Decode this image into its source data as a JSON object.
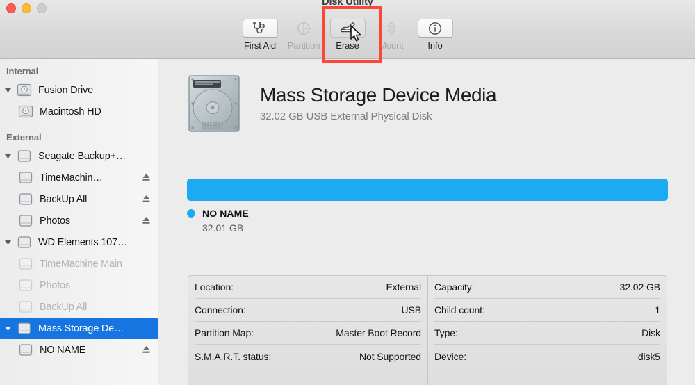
{
  "window": {
    "title": "Disk Utility",
    "traffic_lights": [
      "close",
      "minimize",
      "zoom"
    ]
  },
  "toolbar": {
    "items": [
      {
        "label": "First Aid",
        "icon": "stethoscope-icon",
        "enabled": true,
        "active": false
      },
      {
        "label": "Partition",
        "icon": "pie-chart-icon",
        "enabled": false,
        "active": false
      },
      {
        "label": "Erase",
        "icon": "erase-disk-icon",
        "enabled": true,
        "active": true
      },
      {
        "label": "Mount",
        "icon": "mount-icon",
        "enabled": false,
        "active": false
      },
      {
        "label": "Info",
        "icon": "info-circle-icon",
        "enabled": true,
        "active": false
      }
    ],
    "annotation": {
      "target": "Erase",
      "color": "#f9473c",
      "shape": "rectangle"
    },
    "cursor": {
      "type": "arrow-pointer",
      "over": "Erase"
    }
  },
  "sidebar": {
    "groups": [
      {
        "label": "Internal",
        "rows": [
          {
            "label": "Fusion Drive",
            "icon": "internal-disk-icon",
            "indent": 1,
            "twisty": "down",
            "eject": false,
            "selected": false,
            "dimmed": false
          },
          {
            "label": "Macintosh HD",
            "icon": "internal-disk-icon",
            "indent": 2,
            "twisty": "none",
            "eject": false,
            "selected": false,
            "dimmed": false
          }
        ]
      },
      {
        "label": "External",
        "rows": [
          {
            "label": "Seagate Backup+…",
            "icon": "external-disk-icon",
            "indent": 1,
            "twisty": "down",
            "eject": false,
            "selected": false,
            "dimmed": false
          },
          {
            "label": "TimeMachin…",
            "icon": "external-disk-icon",
            "indent": 2,
            "twisty": "none",
            "eject": true,
            "selected": false,
            "dimmed": false
          },
          {
            "label": "BackUp All",
            "icon": "external-disk-icon",
            "indent": 2,
            "twisty": "none",
            "eject": true,
            "selected": false,
            "dimmed": false
          },
          {
            "label": "Photos",
            "icon": "external-disk-icon",
            "indent": 2,
            "twisty": "none",
            "eject": true,
            "selected": false,
            "dimmed": false
          },
          {
            "label": "WD Elements 107…",
            "icon": "external-disk-icon",
            "indent": 1,
            "twisty": "down",
            "eject": false,
            "selected": false,
            "dimmed": false
          },
          {
            "label": "TimeMachine Main",
            "icon": "external-disk-icon",
            "indent": 2,
            "twisty": "none",
            "eject": false,
            "selected": false,
            "dimmed": true
          },
          {
            "label": "Photos",
            "icon": "external-disk-icon",
            "indent": 2,
            "twisty": "none",
            "eject": false,
            "selected": false,
            "dimmed": true
          },
          {
            "label": "BackUp All",
            "icon": "external-disk-icon",
            "indent": 2,
            "twisty": "none",
            "eject": false,
            "selected": false,
            "dimmed": true
          },
          {
            "label": "Mass Storage De…",
            "icon": "external-disk-icon",
            "indent": 1,
            "twisty": "down",
            "eject": false,
            "selected": true,
            "dimmed": false
          },
          {
            "label": "NO NAME",
            "icon": "external-disk-icon",
            "indent": 2,
            "twisty": "none",
            "eject": true,
            "selected": false,
            "dimmed": false
          }
        ]
      }
    ]
  },
  "main": {
    "disk_icon": "hard-drive-photo-icon",
    "title": "Mass Storage Device Media",
    "subtitle": "32.02 GB USB External Physical Disk",
    "capacity_bar": {
      "color": "#1cabf0",
      "fill_percent": 100
    },
    "legend": {
      "dot_color": "#1cabf0",
      "name": "NO NAME",
      "size": "32.01 GB"
    },
    "info": {
      "left": [
        {
          "label": "Location:",
          "value": "External"
        },
        {
          "label": "Connection:",
          "value": "USB"
        },
        {
          "label": "Partition Map:",
          "value": "Master Boot Record"
        },
        {
          "label": "S.M.A.R.T. status:",
          "value": "Not Supported"
        }
      ],
      "right": [
        {
          "label": "Capacity:",
          "value": "32.02 GB"
        },
        {
          "label": "Child count:",
          "value": "1"
        },
        {
          "label": "Type:",
          "value": "Disk"
        },
        {
          "label": "Device:",
          "value": "disk5"
        }
      ]
    }
  }
}
